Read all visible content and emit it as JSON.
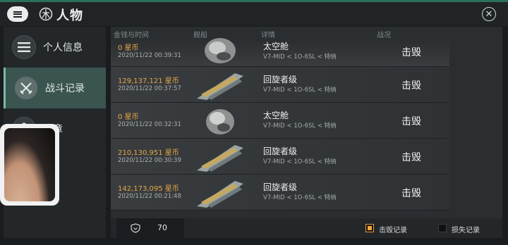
{
  "header": {
    "title": "人物",
    "menu_icon": "menu-icon",
    "title_icon": "character-emblem-icon",
    "close_icon": "close-icon"
  },
  "sidebar": {
    "items": [
      {
        "label": "个人信息",
        "icon": "menu-list-icon",
        "active": false
      },
      {
        "label": "战斗记录",
        "icon": "crossed-swords-icon",
        "active": true
      },
      {
        "label": "勋章",
        "icon": "medal-icon",
        "active": false
      }
    ]
  },
  "columns": {
    "money_time": "金钱与时间",
    "ship": "舰船",
    "details": "详情",
    "battle": "战况"
  },
  "records": [
    {
      "money": "0 星币",
      "time": "2020/11/22 00:39:31",
      "ship": "太空舱",
      "location": "V7-MID < 1O-6SL < 特纳",
      "result": "击毁",
      "ship_icon": "escape-pod-icon"
    },
    {
      "money": "129,137,121 星币",
      "time": "2020/11/22 00:37:57",
      "ship": "回旋者级",
      "location": "V7-MID < 1O-6SL < 特纳",
      "result": "击毁",
      "ship_icon": "gyre-class-ship-icon"
    },
    {
      "money": "0 星币",
      "time": "2020/11/22 00:32:31",
      "ship": "太空舱",
      "location": "V7-MID < 1O-6SL < 特纳",
      "result": "击毁",
      "ship_icon": "escape-pod-icon"
    },
    {
      "money": "210,130,951 星币",
      "time": "2020/11/22 00:30:39",
      "ship": "回旋者级",
      "location": "V7-MID < 1O-6SL < 特纳",
      "result": "击毁",
      "ship_icon": "gyre-class-ship-icon"
    },
    {
      "money": "142,173,095 星币",
      "time": "2020/11/22 00:21:48",
      "ship": "回旋者级",
      "location": "V7-MID < 1O-6SL < 特纳",
      "result": "击毁",
      "ship_icon": "gyre-class-ship-icon"
    }
  ],
  "footer": {
    "count": "70",
    "count_icon": "shield-icon",
    "kill_label": "击毁记录",
    "kill_checked": true,
    "loss_label": "损失记录",
    "loss_checked": false
  },
  "colors": {
    "accent": "#2a6f5a",
    "money": "#e3a645",
    "active_tab": "#3a5450",
    "checkbox_on": "#f0a63f"
  }
}
